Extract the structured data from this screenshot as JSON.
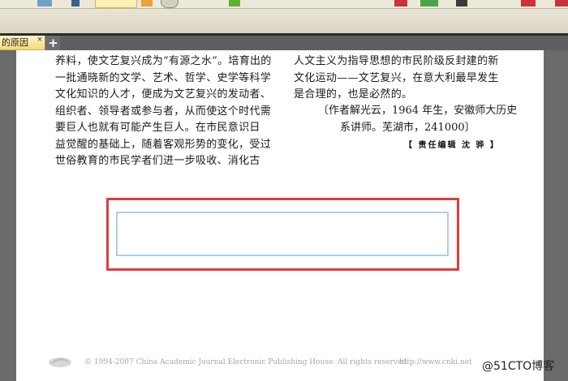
{
  "tab": {
    "title": "的原因",
    "close_glyph": "×",
    "new_tab_glyph": "+"
  },
  "article": {
    "left_lines": [
      "养料，使文艺复兴成为“有源之水”。培育出的",
      "一批通晓新的文学、艺术、哲学、史学等科学",
      "文化知识的人才，便成为文艺复兴的发动者、",
      "组织者、领导者或参与者，从而使这个时代需",
      "要巨人也就有可能产生巨人。在市民意识日",
      "益觉醒的基础上，随着客观形势的变化，受过",
      "世俗教育的市民学者们进一步吸收、消化古"
    ],
    "right_lines": [
      "人文主义为指导思想的市民阶级反封建的新",
      "文化运动——文艺复兴，在意大利最早发生",
      "是合理的，也是必然的。"
    ],
    "author_lines": [
      "〔作者解光云，1964 年生，安徽师大历史",
      "系讲师。芜湖市，241000〕"
    ],
    "editor_note": "【 责任编辑   沈   骅 】"
  },
  "footer": {
    "copyright": "© 1994-2007 China Academic Journal Electronic Publishing House. All rights reserved.",
    "url": "http://www.cnki.net"
  },
  "watermark": "@51CTO博客",
  "form_field": {
    "value": ""
  },
  "colors": {
    "highlight": "#e13c3c",
    "field_border": "#a9d0ee",
    "tab": "#f2d97a"
  }
}
